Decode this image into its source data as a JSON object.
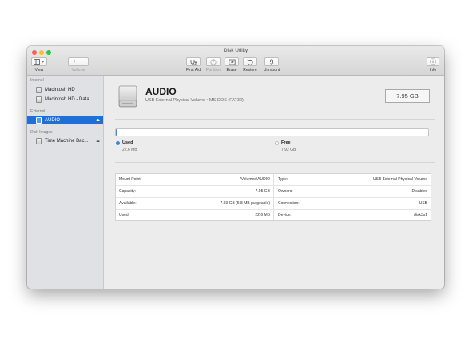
{
  "window": {
    "title": "Disk Utility",
    "traffic_colors": {
      "close": "#fd5e57",
      "minimize": "#febc2e",
      "zoom": "#28c840"
    }
  },
  "toolbar": {
    "view_label": "View",
    "volume_label": "Volume",
    "first_aid_label": "First Aid",
    "partition_label": "Partition",
    "erase_label": "Erase",
    "restore_label": "Restore",
    "unmount_label": "Unmount",
    "info_label": "Info",
    "add_glyph": "+",
    "remove_glyph": "−",
    "info_glyph": "ⓘ"
  },
  "sidebar": {
    "sections": [
      {
        "heading": "Internal",
        "items": [
          {
            "label": "Macintosh HD"
          },
          {
            "label": "Macintosh HD - Data"
          }
        ]
      },
      {
        "heading": "External",
        "items": [
          {
            "label": "AUDIO",
            "selected": true,
            "eject": "⏏"
          }
        ]
      },
      {
        "heading": "Disk Images",
        "items": [
          {
            "label": "Time Machine Bac...",
            "eject": "⏏"
          }
        ]
      }
    ]
  },
  "volume": {
    "name": "AUDIO",
    "subtitle": "USB External Physical Volume • MS-DOS (FAT32)",
    "size": "7.95 GB",
    "used_fraction": 0.003,
    "accent": "#2e8be6"
  },
  "usage": {
    "used_label": "Used",
    "used_value": "22.6 MB",
    "free_label": "Free",
    "free_value": "7.92 GB"
  },
  "info": {
    "left": [
      {
        "key": "Mount Point:",
        "value": "/Volumes/AUDIO"
      },
      {
        "key": "Capacity:",
        "value": "7.95 GB"
      },
      {
        "key": "Available:",
        "value": "7.93 GB (5.8 MB purgeable)"
      },
      {
        "key": "Used:",
        "value": "22.6 MB"
      }
    ],
    "right": [
      {
        "key": "Type:",
        "value": "USB External Physical Volume"
      },
      {
        "key": "Owners:",
        "value": "Disabled"
      },
      {
        "key": "Connection:",
        "value": "USB"
      },
      {
        "key": "Device:",
        "value": "disk3s1"
      }
    ]
  }
}
